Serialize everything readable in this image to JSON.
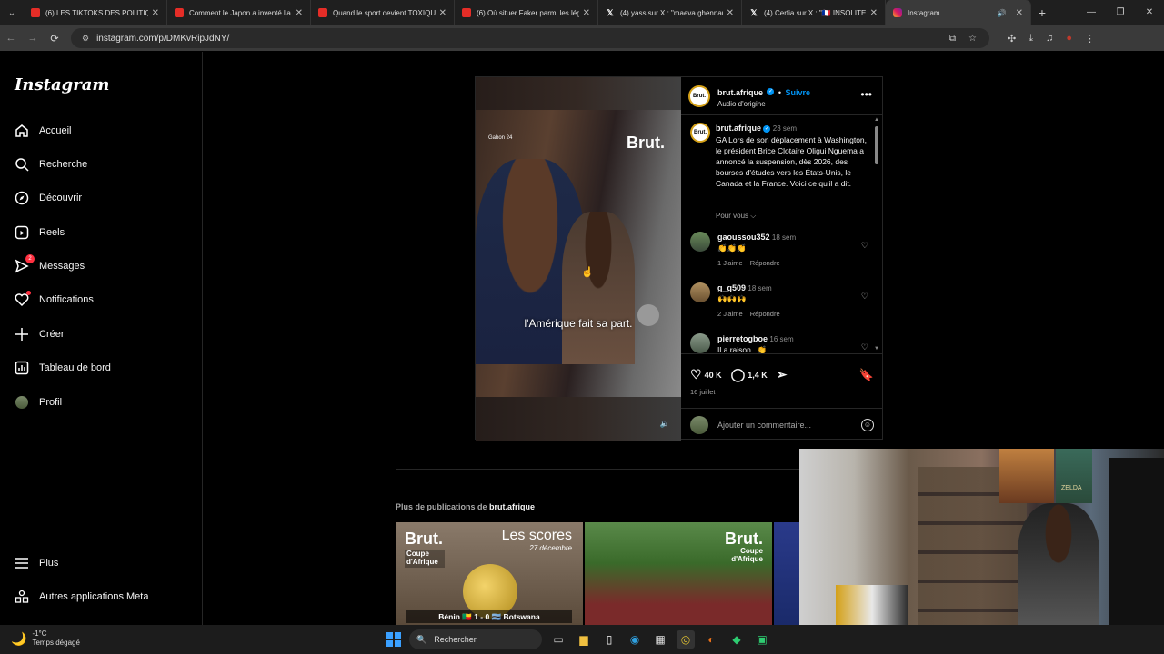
{
  "browser": {
    "tabs": [
      {
        "title": "(6) LES TIKTOKS DES POLITIQUE",
        "icon": "youtube-icon"
      },
      {
        "title": "Comment le Japon a inventé l'a",
        "icon": "youtube-icon"
      },
      {
        "title": "Quand le sport devient TOXIQU",
        "icon": "youtube-icon"
      },
      {
        "title": "(6) Où situer Faker parmi les lég",
        "icon": "youtube-icon"
      },
      {
        "title": "(4) yass sur X : \"maeva ghennam",
        "icon": "x-icon"
      },
      {
        "title": "(4) Cerfia sur X : \"🇫🇷 INSOLITE |",
        "icon": "x-icon"
      },
      {
        "title": "Instagram",
        "icon": "instagram-icon",
        "active": true
      }
    ],
    "url": "instagram.com/p/DMKvRipJdNY/"
  },
  "sidebar": {
    "logo": "Instagram",
    "items": [
      {
        "label": "Accueil",
        "icon": "home-icon"
      },
      {
        "label": "Recherche",
        "icon": "search-icon"
      },
      {
        "label": "Découvrir",
        "icon": "compass-icon"
      },
      {
        "label": "Reels",
        "icon": "reels-icon"
      },
      {
        "label": "Messages",
        "icon": "messenger-icon",
        "badge": "2"
      },
      {
        "label": "Notifications",
        "icon": "heart-icon"
      },
      {
        "label": "Créer",
        "icon": "plus-icon"
      },
      {
        "label": "Tableau de bord",
        "icon": "dashboard-icon"
      },
      {
        "label": "Profil",
        "icon": "avatar"
      }
    ],
    "more": "Plus",
    "meta": "Autres applications Meta"
  },
  "post": {
    "video": {
      "source_label": "Gabon 24",
      "brand": "Brut.",
      "subtitle": "l'Amérique fait sa part."
    },
    "author": "brut.afrique",
    "follow": "Suivre",
    "audio": "Audio d'origine",
    "caption": {
      "user": "brut.afrique",
      "time": "23 sem",
      "text": "GA Lors de son déplacement à Washington, le président Brice Clotaire Oligui Nguema a annoncé la suspension, dès 2026, des bourses d'études vers les États-Unis, le Canada et la France. Voici ce qu'il a dit."
    },
    "see_all": "Pour vous ⌵",
    "comments": [
      {
        "user": "gaoussou352",
        "time": "18 sem",
        "text": "👏👏👏",
        "likes": "1 J'aime",
        "reply": "Répondre"
      },
      {
        "user": "g_g509",
        "time": "18 sem",
        "text": "🙌🙌🙌",
        "likes": "2 J'aime",
        "reply": "Répondre"
      },
      {
        "user": "pierretogboe",
        "time": "16 sem",
        "text": "Il a raison...👏"
      }
    ],
    "likes": "40 K",
    "comment_count": "1,4 K",
    "date": "16 juillet",
    "add_comment_placeholder": "Ajouter un commentaire..."
  },
  "more_posts": {
    "prefix": "Plus de publications de",
    "user": "brut.afrique",
    "thumbs": [
      {
        "brand": "Brut.",
        "tag": "Coupe d'Afrique",
        "title": "Les scores",
        "date": "27 décembre",
        "scoreline": "Bénin 🇧🇯 1 - 0 🇧🇼 Botswana"
      },
      {
        "brand": "Brut.",
        "tag": "Coupe d'Afrique"
      }
    ]
  },
  "webcam": {
    "poster_text": "ZELDA"
  },
  "taskbar": {
    "temp": "-1°C",
    "weather": "Temps dégagé",
    "search": "Rechercher"
  }
}
